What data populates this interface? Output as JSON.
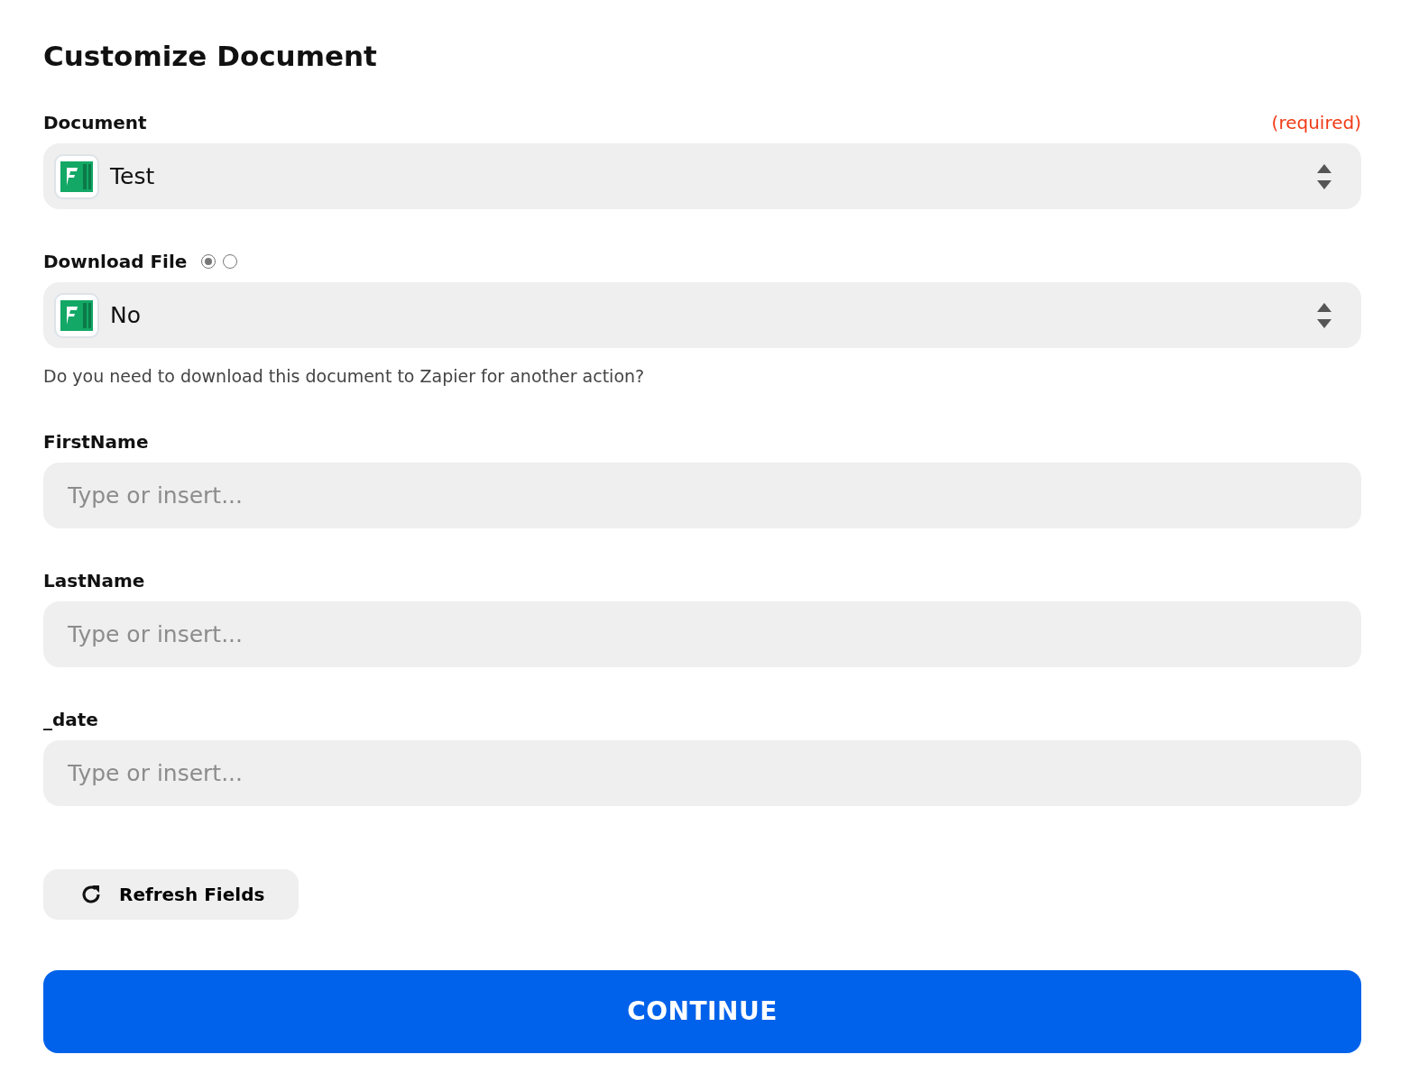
{
  "title": "Customize Document",
  "fields": [
    {
      "kind": "select",
      "label": "Document",
      "required_note": "(required)",
      "value": "Test"
    },
    {
      "kind": "select",
      "label": "Download File",
      "radios": [
        {
          "selected": true
        },
        {
          "selected": false
        }
      ],
      "value": "No",
      "help": "Do you need to download this document to Zapier for another action?"
    },
    {
      "kind": "text",
      "label": "FirstName",
      "placeholder": "Type or insert..."
    },
    {
      "kind": "text",
      "label": "LastName",
      "placeholder": "Type or insert..."
    },
    {
      "kind": "text",
      "label": "_date",
      "placeholder": "Type or insert..."
    }
  ],
  "refresh_button": "Refresh Fields",
  "continue_button": "CONTINUE"
}
